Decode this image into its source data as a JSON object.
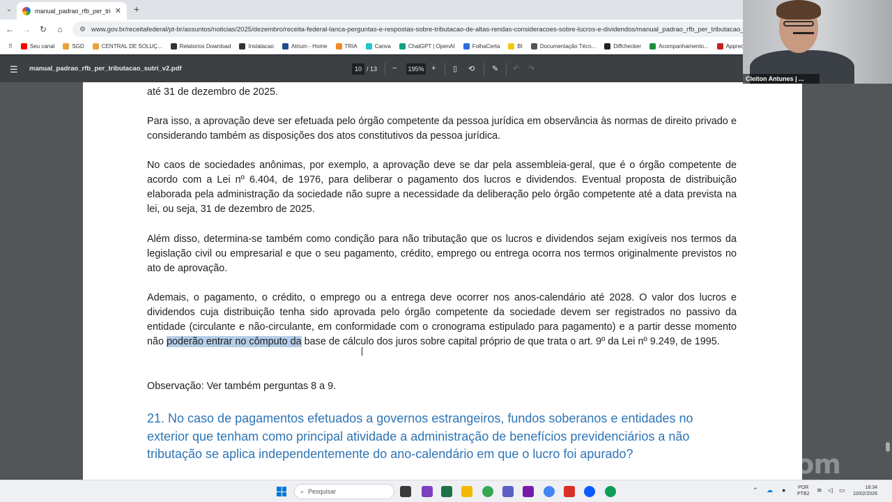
{
  "browser": {
    "tab_title": "manual_padrao_rfb_per_tributac",
    "tab_close": "✕",
    "new_tab": "+",
    "url": "www.gov.br/receitafederal/pt-br/assuntos/noticias/2025/dezembro/receita-federal-lanca-perguntas-e-respostas-sobre-tributacao-de-altas-rendas-consideracoes-sobre-lucros-e-dividendos/manual_padrao_rfb_per_tributacao_sutri",
    "bookmarks": [
      {
        "label": "Seu canal",
        "color": "#ff0000"
      },
      {
        "label": "SGD",
        "color": "#e8a33a"
      },
      {
        "label": "CENTRAL DE SOLUÇ...",
        "color": "#e8a33a"
      },
      {
        "label": "Relatorios Download",
        "color": "#333333"
      },
      {
        "label": "Instalacao",
        "color": "#333333"
      },
      {
        "label": "Atrium - Home",
        "color": "#1d4e89"
      },
      {
        "label": "TRIA",
        "color": "#f08a24"
      },
      {
        "label": "Canva",
        "color": "#20c4cb"
      },
      {
        "label": "ChatGPT | OpenAI",
        "color": "#10a37f"
      },
      {
        "label": "FolhaCerta",
        "color": "#2d6cdf"
      },
      {
        "label": "BI",
        "color": "#f2c811"
      },
      {
        "label": "Documentação Técn...",
        "color": "#555555"
      },
      {
        "label": "Diffchecker",
        "color": "#222222"
      },
      {
        "label": "Acompanhamento...",
        "color": "#1e8e3e"
      },
      {
        "label": "Apprec",
        "color": "#c5221f"
      }
    ]
  },
  "pdf": {
    "file_name": "manual_padrao_rfb_per_tributacao_sutri_v2.pdf",
    "page_current": "10",
    "page_total": "/ 13",
    "zoom": "195%",
    "zoom_out": "−",
    "zoom_in": "+"
  },
  "document": {
    "p0": "até 31 de dezembro de 2025.",
    "p1": "Para isso, a aprovação deve ser efetuada pelo órgão competente da pessoa jurídica em observância às normas de direito privado e considerando também as disposições dos atos constitutivos da pessoa jurídica.",
    "p2": "No caos de sociedades anônimas, por exemplo, a aprovação deve se dar pela assembleia-geral, que é o órgão competente de acordo com a Lei nº 6.404, de 1976, para deliberar o pagamento dos lucros e dividendos. Eventual proposta de distribuição elaborada pela administração da sociedade não supre a necessidade da deliberação pelo órgão competente até a data prevista na lei, ou seja, 31 de dezembro de 2025.",
    "p3": "Além disso, determina-se também como condição para não tributação que os lucros e dividendos sejam exigíveis nos termos da legislação civil ou empresarial e que o seu pagamento, crédito, emprego ou entrega ocorra nos termos originalmente previstos no ato de aprovação.",
    "p4_before": "Ademais, o pagamento, o crédito, o emprego ou a entrega deve ocorrer nos anos-calendário até 2028. O valor dos lucros e dividendos cuja distribuição tenha sido aprovada  pelo órgão competente da sociedade devem ser registrados no passivo da entidade (circulante e não-circulante, em conformidade com o cronograma estipulado para pagamento) e a partir desse momento não ",
    "p4_selected": "poderão entrar no cômputo da",
    "p4_after": " base de cálculo dos juros sobre capital próprio de que trata o art. 9º da Lei nº 9.249, de 1995.",
    "p5": "Observação: Ver também perguntas 8 a 9.",
    "heading": "21. No caso de pagamentos efetuados a governos estrangeiros, fundos soberanos e entidades no exterior que tenham como principal atividade a administração de benefícios previdenciários a não tributação se aplica independentemente do ano-calendário em que o lucro foi apurado?"
  },
  "webcam": {
    "participant": "Cleiton Antunes | ..."
  },
  "watermark": "zoom",
  "taskbar": {
    "search_placeholder": "Pesquisar",
    "language_line1": "POR",
    "language_line2": "PTB2",
    "time": "18:34",
    "date": "10/02/2026"
  }
}
